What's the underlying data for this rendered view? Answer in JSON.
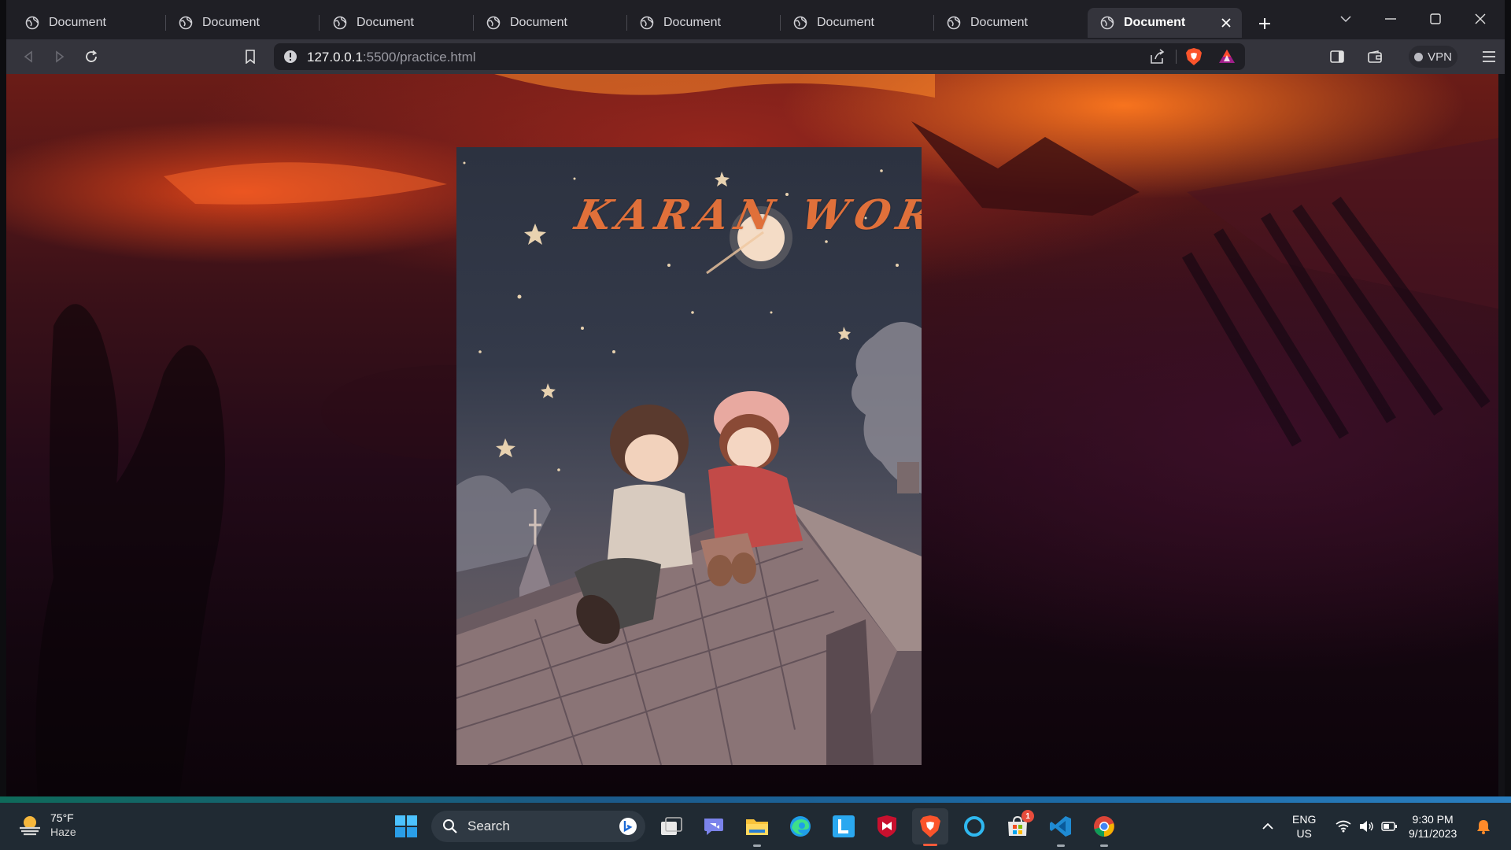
{
  "browser": {
    "tabs": [
      {
        "label": "Document"
      },
      {
        "label": "Document"
      },
      {
        "label": "Document"
      },
      {
        "label": "Document"
      },
      {
        "label": "Document"
      },
      {
        "label": "Document"
      },
      {
        "label": "Document"
      },
      {
        "label": "Document",
        "active": true
      }
    ],
    "address": {
      "host": "127.0.0.1",
      "path": ":5500/practice.html"
    },
    "vpn_label": "VPN"
  },
  "page": {
    "poster_title": "KARAN WORLD"
  },
  "taskbar": {
    "weather": {
      "temp": "75°F",
      "condition": "Haze"
    },
    "search_placeholder": "Search",
    "store_badge": "1",
    "language": {
      "line1": "ENG",
      "line2": "US"
    },
    "clock": {
      "time": "9:30 PM",
      "date": "9/11/2023"
    }
  },
  "colors": {
    "accent_brave": "#fb542b",
    "title_orange": "#e0703a",
    "tab_active_bg": "#34343c"
  }
}
